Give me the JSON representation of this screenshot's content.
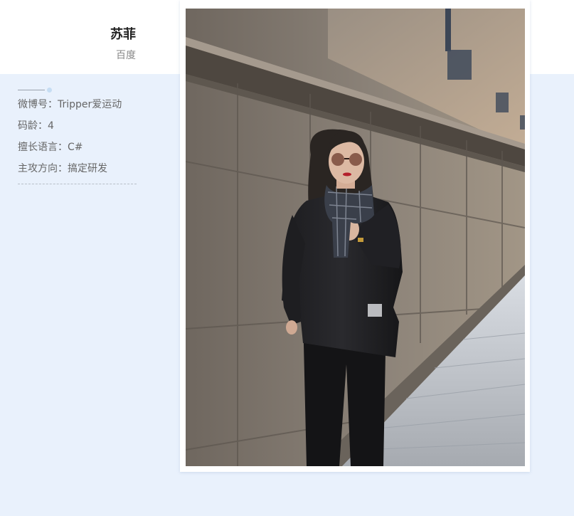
{
  "profile": {
    "name": "苏菲",
    "company": "百度"
  },
  "info": {
    "rows": [
      {
        "label": "微博号：",
        "value": "Tripper爱运动"
      },
      {
        "label": "码龄：",
        "value": "4"
      },
      {
        "label": "擅长语言：",
        "value": "C#"
      },
      {
        "label": "主攻方向：",
        "value": "搞定研发"
      }
    ]
  },
  "photo": {
    "subject": "woman-in-black-suit-with-plaid-scarf-and-sunglasses",
    "setting": "stone-building-wall-and-paved-sidewalk"
  },
  "colors": {
    "page_background": "#e9f1fc",
    "header_background": "#ffffff",
    "name_text": "#222222",
    "secondary_text": "#888888",
    "info_text": "#666666",
    "accent_dot": "#c6ddf3"
  }
}
